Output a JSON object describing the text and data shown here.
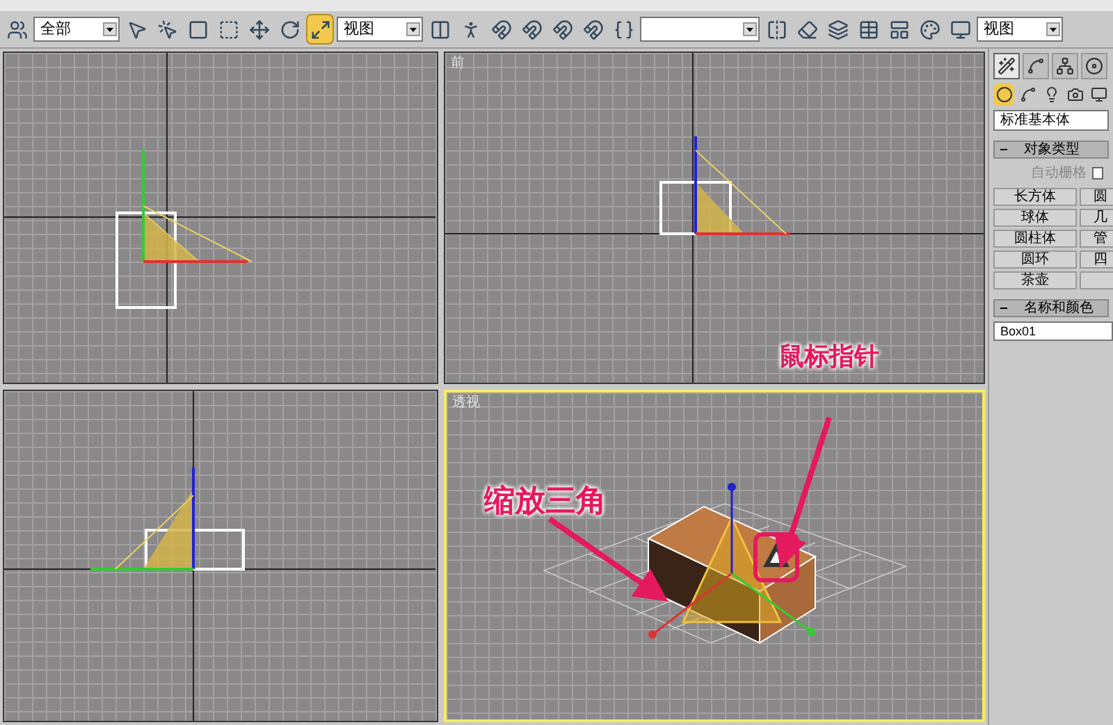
{
  "toolbar": [
    {
      "kind": "button",
      "selected": false
    },
    {
      "kind": "dropdown",
      "value": "全部"
    },
    {
      "kind": "button",
      "selected": false
    },
    {
      "kind": "button",
      "selected": false
    },
    {
      "kind": "button",
      "selected": false
    },
    {
      "kind": "button",
      "selected": false
    },
    {
      "kind": "button",
      "selected": false
    },
    {
      "kind": "button",
      "selected": false
    },
    {
      "kind": "button",
      "selected": true
    },
    {
      "kind": "dropdown",
      "value": "视图"
    },
    {
      "kind": "button",
      "selected": false
    },
    {
      "kind": "button",
      "selected": false
    },
    {
      "kind": "button",
      "selected": false
    },
    {
      "kind": "button",
      "selected": false
    },
    {
      "kind": "button",
      "selected": false
    },
    {
      "kind": "button",
      "selected": false
    },
    {
      "kind": "button",
      "selected": false
    },
    {
      "kind": "dropdown"
    },
    {
      "kind": "button",
      "selected": false
    },
    {
      "kind": "button",
      "selected": false
    },
    {
      "kind": "button",
      "selected": false
    },
    {
      "kind": "button",
      "selected": false
    },
    {
      "kind": "button",
      "selected": false
    },
    {
      "kind": "button",
      "selected": false
    },
    {
      "kind": "button",
      "selected": false
    },
    {
      "kind": "dropdown",
      "value": "视图"
    }
  ],
  "viewports": [
    {
      "kind": "top",
      "active": false
    },
    {
      "label": "前",
      "kind": "front",
      "active": false
    },
    {
      "kind": "left",
      "active": false
    },
    {
      "label": "透视",
      "kind": "perspective",
      "active": true
    }
  ],
  "annotations": [
    {
      "text": "缩放三角"
    },
    {
      "text": "鼠标指针"
    }
  ],
  "command_panel": {
    "tabs": [
      {
        "selected": true
      },
      {
        "selected": false
      },
      {
        "selected": false
      },
      {
        "selected": false
      }
    ],
    "categories": [
      {
        "selected": true
      },
      {
        "selected": false
      },
      {
        "selected": false
      },
      {
        "selected": false
      },
      {
        "selected": false
      }
    ],
    "type_dropdown": "标准基本体",
    "object_type": {
      "title": "对象类型",
      "autogrid": "自动栅格",
      "autogrid_checked": false,
      "buttons": [
        "长方体",
        "圆",
        "球体",
        "几",
        "圆柱体",
        "管",
        "圆环",
        "四",
        "茶壶"
      ]
    },
    "name_color": {
      "title": "名称和颜色",
      "name": "Box01"
    }
  }
}
